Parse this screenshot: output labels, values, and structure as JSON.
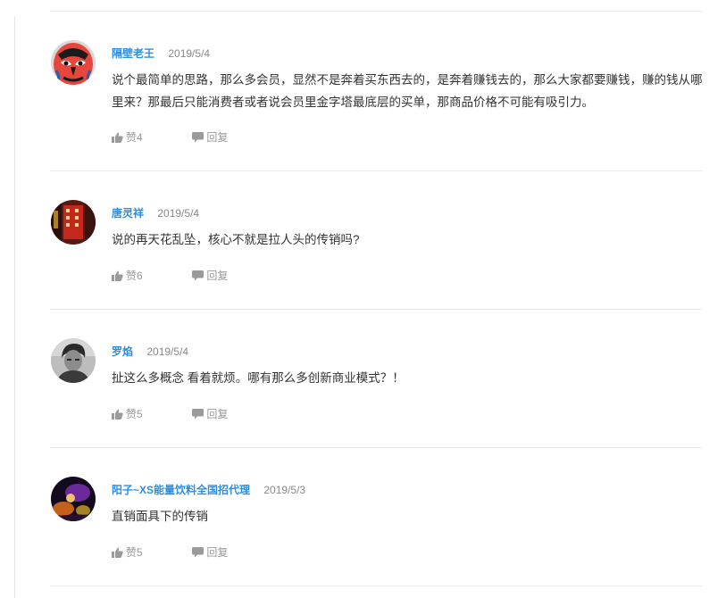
{
  "comments": [
    {
      "user": "隔壁老王",
      "date": "2019/5/4",
      "text": "说个最简单的思路，那么多会员，显然不是奔着买东西去的，是奔着赚钱去的，那么大家都要赚钱，赚的钱从哪里来？那最后只能消费者或者说会员里金字塔最底层的买单，那商品价格不可能有吸引力。",
      "like": "赞4",
      "reply": "回复"
    },
    {
      "user": "唐灵祥",
      "date": "2019/5/4",
      "text": "说的再天花乱坠，核心不就是拉人头的传销吗?",
      "like": "赞6",
      "reply": "回复"
    },
    {
      "user": "罗焰",
      "date": "2019/5/4",
      "text": "扯这么多概念 看着就烦。哪有那么多创新商业模式？！",
      "like": "赞5",
      "reply": "回复"
    },
    {
      "user": "阳子~XS能量饮料全国招代理",
      "date": "2019/5/3",
      "text": "直销面具下的传销",
      "like": "赞5",
      "reply": "回复"
    }
  ],
  "icons": {
    "like": "thumbs-up-icon",
    "reply": "speech-bubble-icon"
  },
  "colors": {
    "username": "#2d8ee0",
    "meta": "#999999",
    "text": "#333333",
    "divider": "#ececec"
  }
}
